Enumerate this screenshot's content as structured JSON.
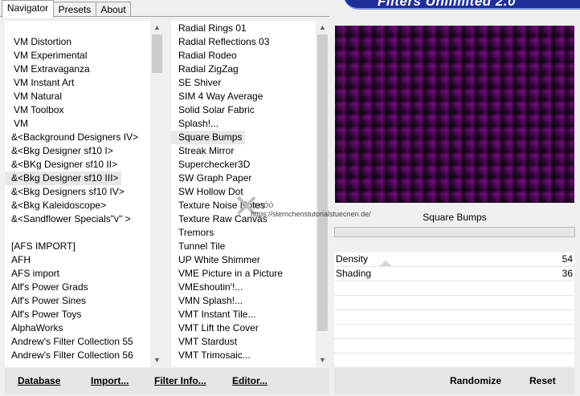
{
  "tabs": [
    "Navigator",
    "Presets",
    "About"
  ],
  "banner": {
    "title": "Filters Unlimited 2.0"
  },
  "categories": [
    "VM Distortion",
    "VM Experimental",
    "VM Extravaganza",
    "VM Instant Art",
    "VM Natural",
    "VM Toolbox",
    "VM",
    "&<Background Designers IV>",
    "&<Bkg Designer sf10 I>",
    "&<BKg Designer sf10 II>",
    "&<Bkg Designer sf10 III>",
    "&<Bkg Designers sf10 IV>",
    "&<Bkg Kaleidoscope>",
    "&<Sandflower Specials\"v\" >",
    "",
    "[AFS IMPORT]",
    "AFH",
    "AFS import",
    "Alf's Power Grads",
    "Alf's Power Sines",
    "Alf's Power Toys",
    "AlphaWorks",
    "Andrew's Filter Collection 55",
    "Andrew's Filter Collection 56"
  ],
  "filters": [
    "Radial  Rings 01",
    "Radial Reflections 03",
    "Radial Rodeo",
    "Radial ZigZag",
    "SE Shiver",
    "SIM 4 Way Average",
    "Solid Solar Fabric",
    "Splash!...",
    "Square Bumps",
    "Streak Mirror",
    "Superchecker3D",
    "SW Graph Paper",
    "SW Hollow Dot",
    "Texture Noise Notes",
    "Texture Raw Canvas",
    "Tremors",
    "Tunnel Tile",
    "UP White Shimmer",
    "VME Picture in a Picture",
    "VMEshoutin'!...",
    "VMN Splash!...",
    "VMT Instant Tile...",
    "VMT Lift the Cover",
    "VMT Stardust",
    "VMT Trimosaic..."
  ],
  "selected_category": "&<Bkg Designer sf10 III>",
  "selected_filter": "Square Bumps",
  "preview": {
    "filter_name": "Square Bumps"
  },
  "watermark": {
    "name": "nnóó",
    "url": "https://sternchenstutorialstuecnen.de/"
  },
  "params": [
    {
      "label": "Density",
      "value": "54"
    },
    {
      "label": "Shading",
      "value": "36"
    }
  ],
  "buttons": {
    "database": "Database",
    "import": "Import...",
    "filter_info": "Filter Info...",
    "editor": "Editor...",
    "randomize": "Randomize",
    "reset": "Reset"
  }
}
